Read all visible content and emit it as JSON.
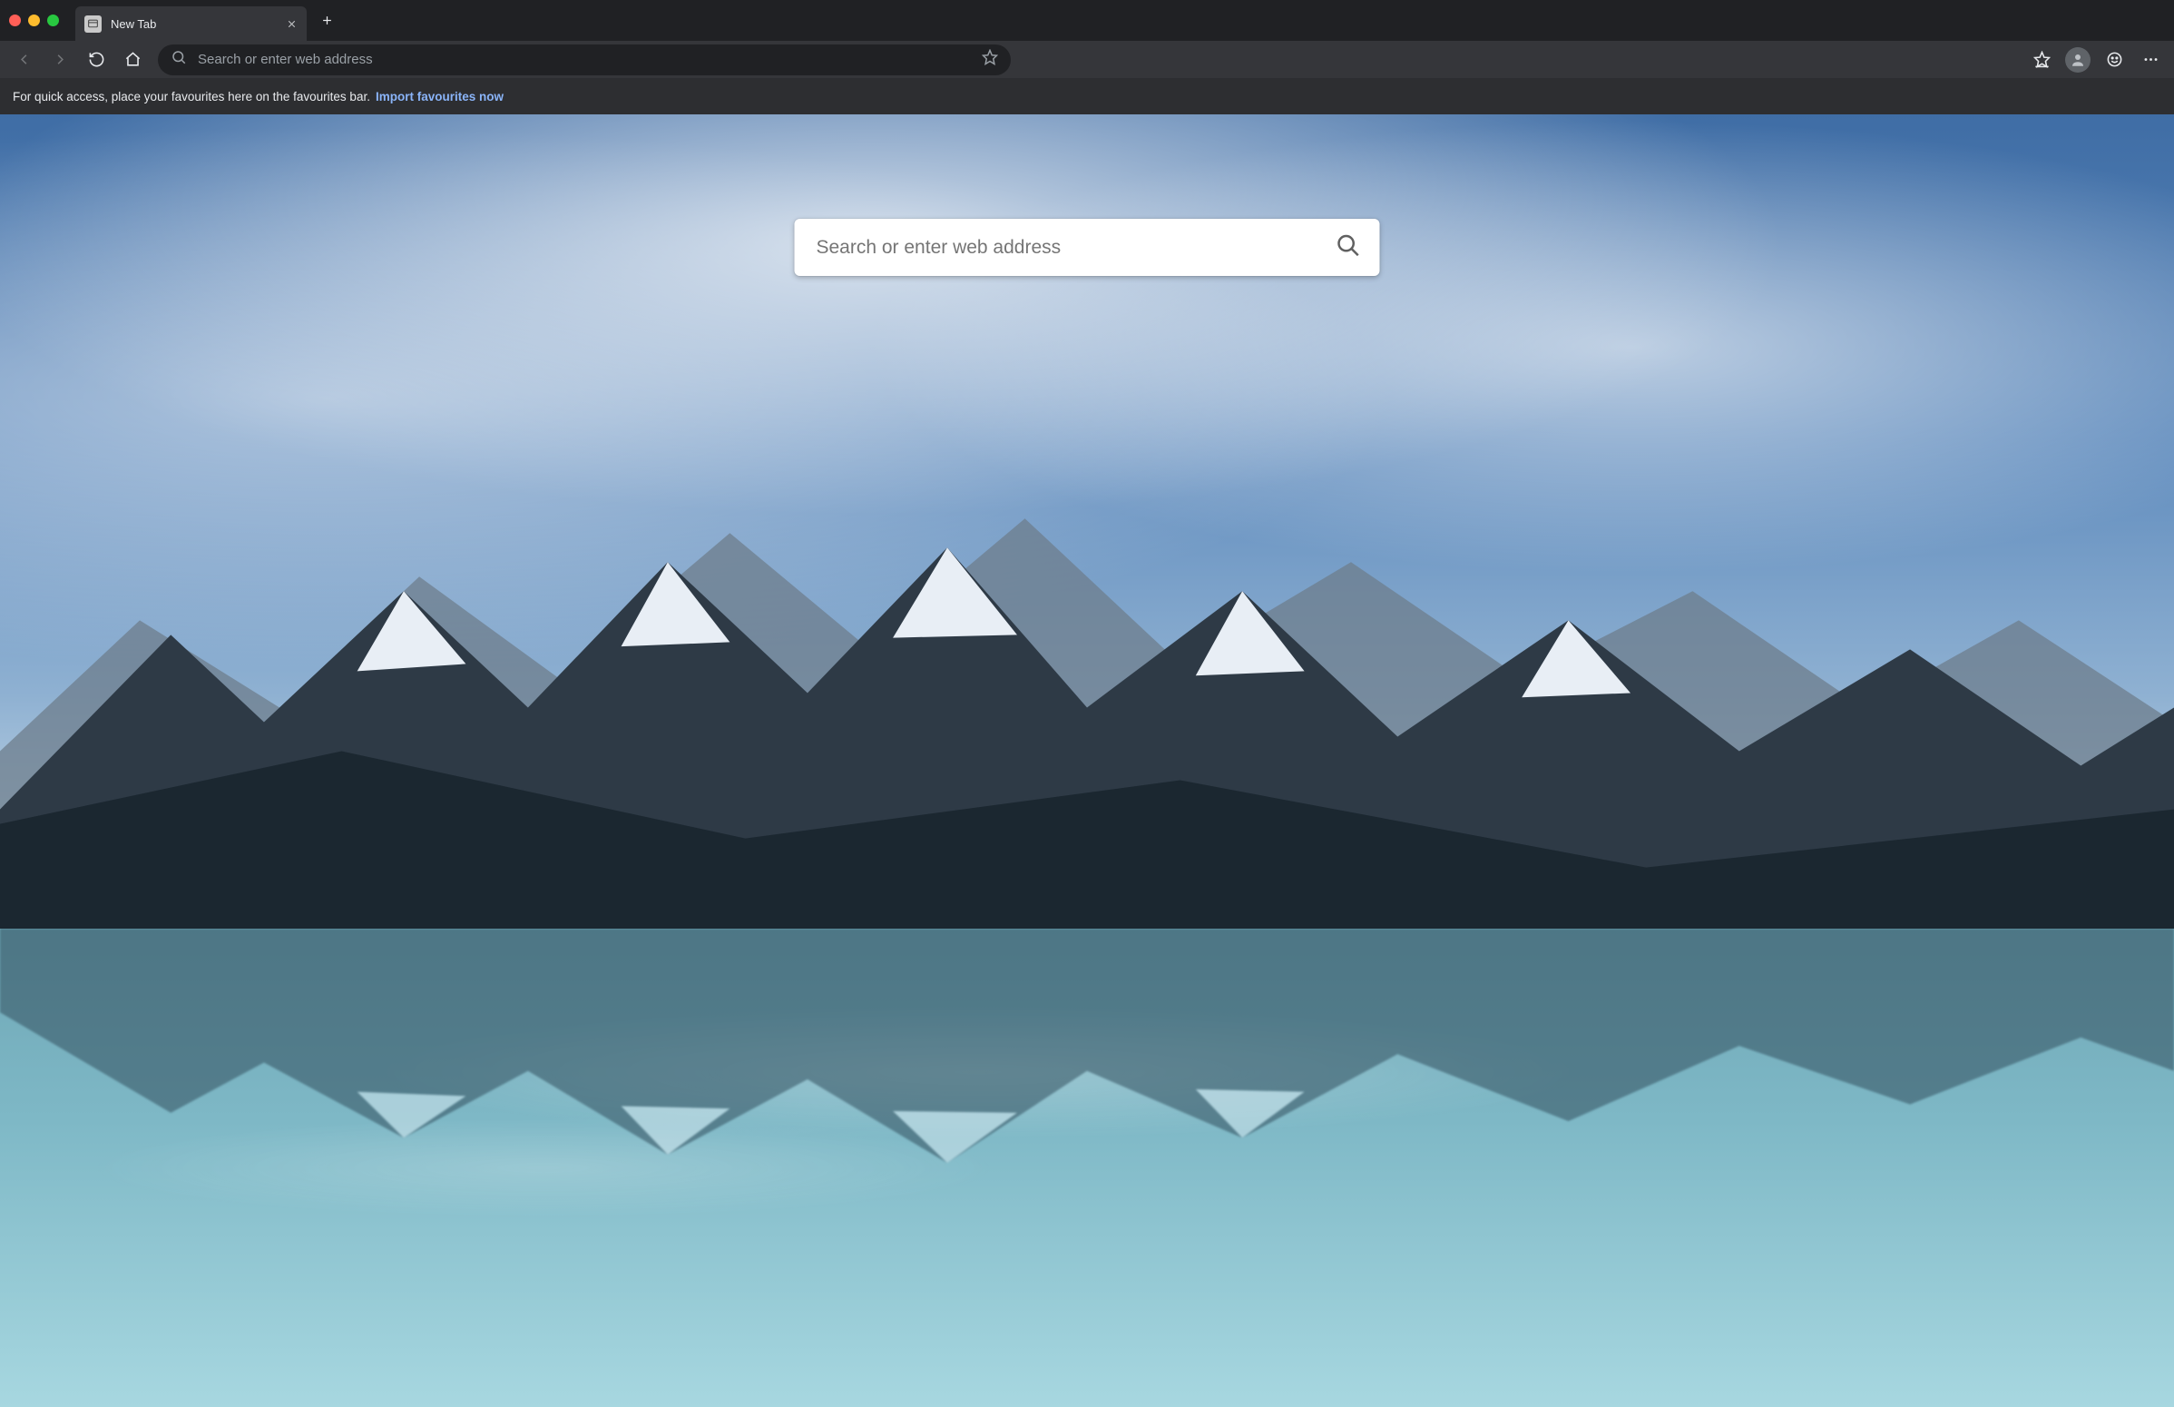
{
  "tab": {
    "title": "New Tab"
  },
  "omnibox": {
    "placeholder": "Search or enter web address"
  },
  "favbar": {
    "text": "For quick access, place your favourites here on the favourites bar.",
    "link": "Import favourites now"
  },
  "page_search": {
    "placeholder": "Search or enter web address"
  }
}
